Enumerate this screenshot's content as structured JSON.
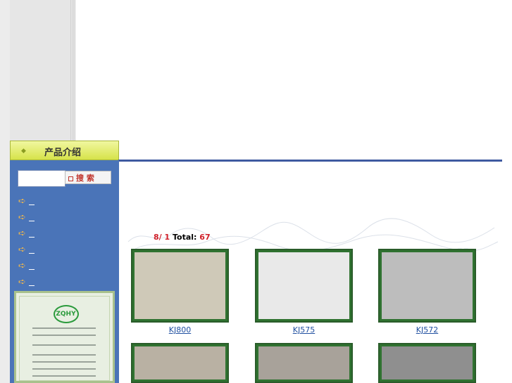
{
  "sidebar": {
    "header_title": "产品介绍",
    "search_button_label": "搜 索",
    "search_placeholder": "",
    "menu_items": [
      "",
      "",
      "",
      "",
      "",
      ""
    ]
  },
  "listing": {
    "page_current": "8/ 1",
    "total_label": "Total:",
    "total_value": "67",
    "pager_text": "_ _"
  },
  "products": [
    {
      "code": "KJ800"
    },
    {
      "code": "KJ575"
    },
    {
      "code": "KJ572"
    },
    {
      "code": ""
    },
    {
      "code": ""
    },
    {
      "code": ""
    }
  ],
  "colors": {
    "sidebar_blue": "#4a74b8",
    "header_green": "#d6e34a",
    "accent_red": "#d0202a",
    "link_blue": "#1f4fa0"
  },
  "icons": {
    "menu_bullet": "arrow-right-icon",
    "search_bullet": "square-icon"
  }
}
